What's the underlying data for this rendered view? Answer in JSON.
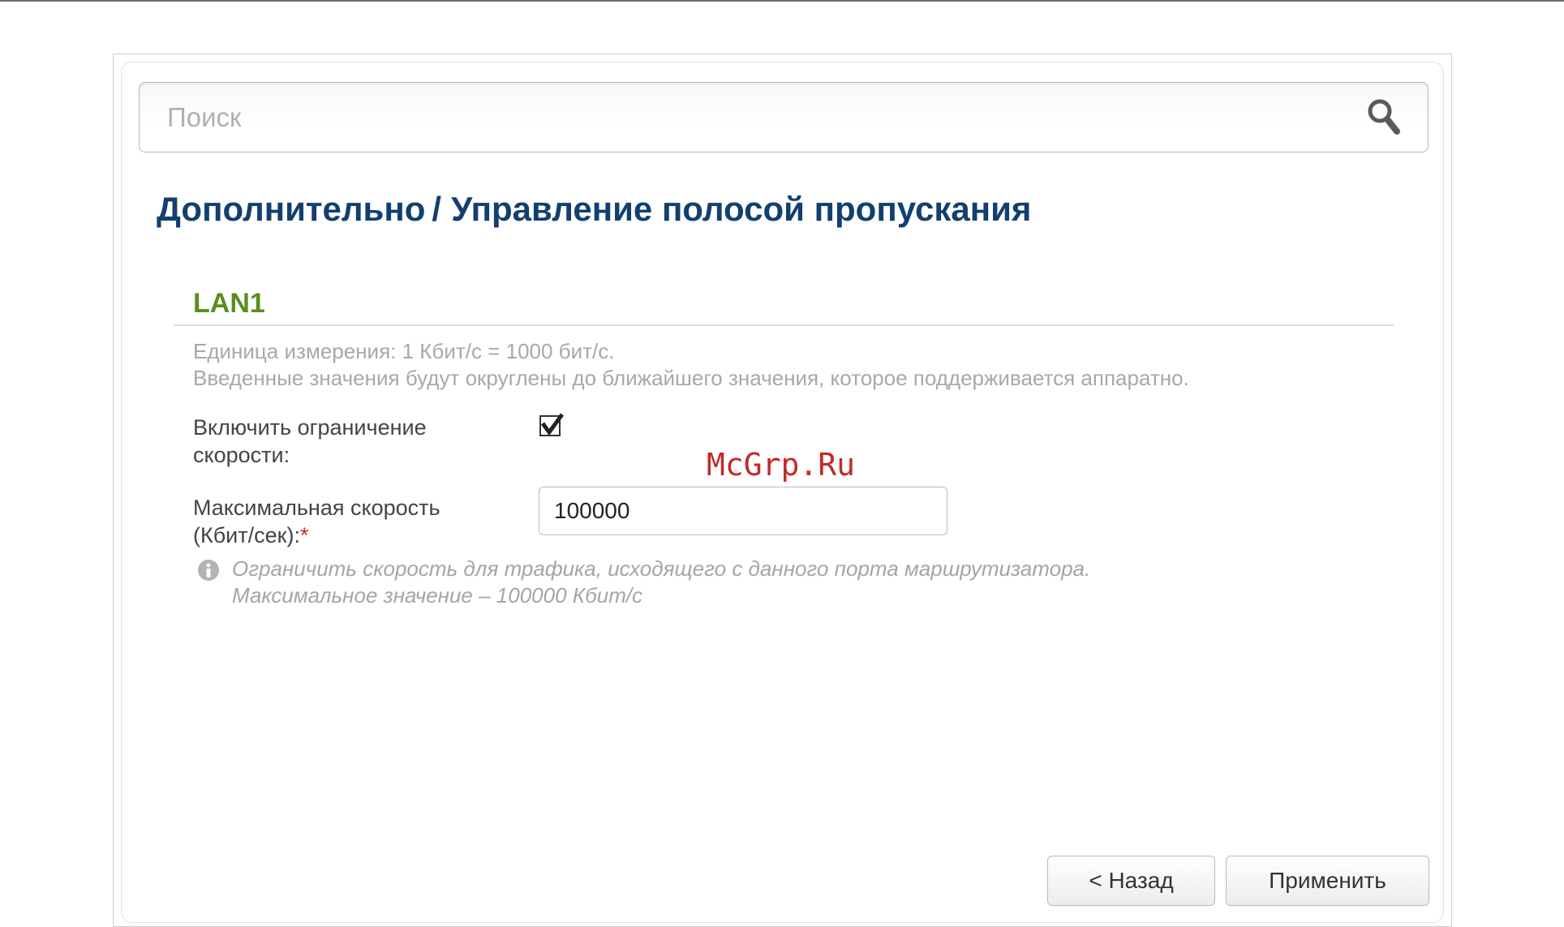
{
  "search": {
    "placeholder": "Поиск",
    "value": ""
  },
  "header": {
    "breadcrumb_parent": "Дополнительно",
    "breadcrumb_separator": "/",
    "page_title": "Управление полосой пропускания"
  },
  "section": {
    "title": "LAN1",
    "notes": [
      "Единица измерения: 1 Кбит/c = 1000 бит/с.",
      "Введенные значения будут округлены до ближайшего значения, которое поддерживается аппаратно."
    ]
  },
  "form": {
    "enable_limit": {
      "label_line1": "Включить ограничение",
      "label_line2": "скорости:",
      "checked": true
    },
    "max_speed": {
      "label_line1": "Максимальная скорость",
      "label_line2": "(Кбит/сек):",
      "required_mark": "*",
      "value": "100000"
    },
    "hint": {
      "line1": "Ограничить скорость для трафика, исходящего с данного порта маршрутизатора.",
      "line2": "Максимальное значение – 100000 Кбит/с"
    }
  },
  "watermark": "McGrp.Ru",
  "buttons": {
    "back_label": "< Назад",
    "apply_label": "Применить"
  },
  "icons": {
    "search": "search-icon",
    "info": "info-icon",
    "check": "checkmark-icon"
  },
  "colors": {
    "title": "#123f70",
    "section_title": "#5a8e1e",
    "required": "#d8282a",
    "watermark": "#c42a2a"
  }
}
